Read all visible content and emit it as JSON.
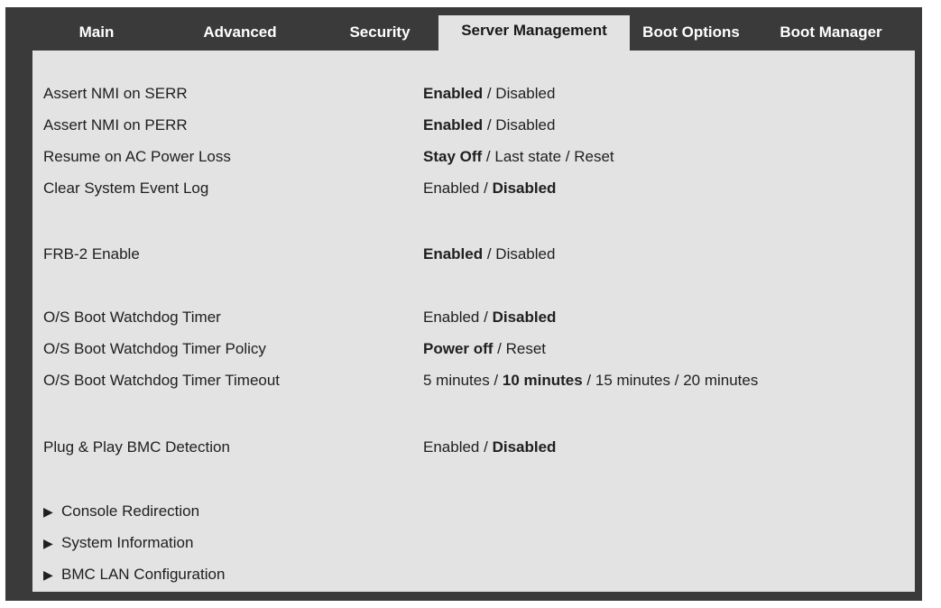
{
  "tabs": [
    {
      "label": "Main",
      "active": false
    },
    {
      "label": "Advanced",
      "active": false
    },
    {
      "label": "Security",
      "active": false
    },
    {
      "label": "Server Management",
      "active": true
    },
    {
      "label": "Boot Options",
      "active": false
    },
    {
      "label": "Boot Manager",
      "active": false
    }
  ],
  "settings": [
    {
      "label": "Assert NMI on SERR",
      "options": [
        {
          "text": "Enabled",
          "selected": true
        },
        {
          "text": "Disabled",
          "selected": false
        }
      ]
    },
    {
      "label": "Assert NMI on PERR",
      "options": [
        {
          "text": "Enabled",
          "selected": true
        },
        {
          "text": "Disabled",
          "selected": false
        }
      ]
    },
    {
      "label": "Resume on AC Power Loss",
      "options": [
        {
          "text": "Stay Off",
          "selected": true
        },
        {
          "text": "Last state",
          "selected": false
        },
        {
          "text": "Reset",
          "selected": false
        }
      ]
    },
    {
      "label": "Clear System Event Log",
      "options": [
        {
          "text": "Enabled",
          "selected": false
        },
        {
          "text": "Disabled",
          "selected": true
        }
      ]
    },
    {
      "label": "FRB-2 Enable",
      "options": [
        {
          "text": "Enabled",
          "selected": true
        },
        {
          "text": "Disabled",
          "selected": false
        }
      ]
    },
    {
      "label": "O/S Boot Watchdog Timer",
      "options": [
        {
          "text": "Enabled",
          "selected": false
        },
        {
          "text": "Disabled",
          "selected": true
        }
      ]
    },
    {
      "label": "O/S Boot Watchdog Timer Policy",
      "options": [
        {
          "text": "Power off",
          "selected": true
        },
        {
          "text": "Reset",
          "selected": false
        }
      ]
    },
    {
      "label": "O/S Boot Watchdog Timer Timeout",
      "options": [
        {
          "text": "5 minutes",
          "selected": false
        },
        {
          "text": "10 minutes",
          "selected": true
        },
        {
          "text": "15 minutes",
          "selected": false
        },
        {
          "text": "20 minutes",
          "selected": false
        }
      ]
    },
    {
      "label": "Plug & Play BMC Detection",
      "options": [
        {
          "text": "Enabled",
          "selected": false
        },
        {
          "text": "Disabled",
          "selected": true
        }
      ]
    }
  ],
  "option_separator": " / ",
  "submenus": [
    {
      "label": "Console Redirection",
      "icon": "right-triangle-icon"
    },
    {
      "label": "System Information",
      "icon": "right-triangle-icon"
    },
    {
      "label": "BMC LAN Configuration",
      "icon": "right-triangle-icon"
    }
  ],
  "colors": {
    "frame": "#3a3a3a",
    "panel": "#e3e3e3",
    "text": "#202020"
  }
}
